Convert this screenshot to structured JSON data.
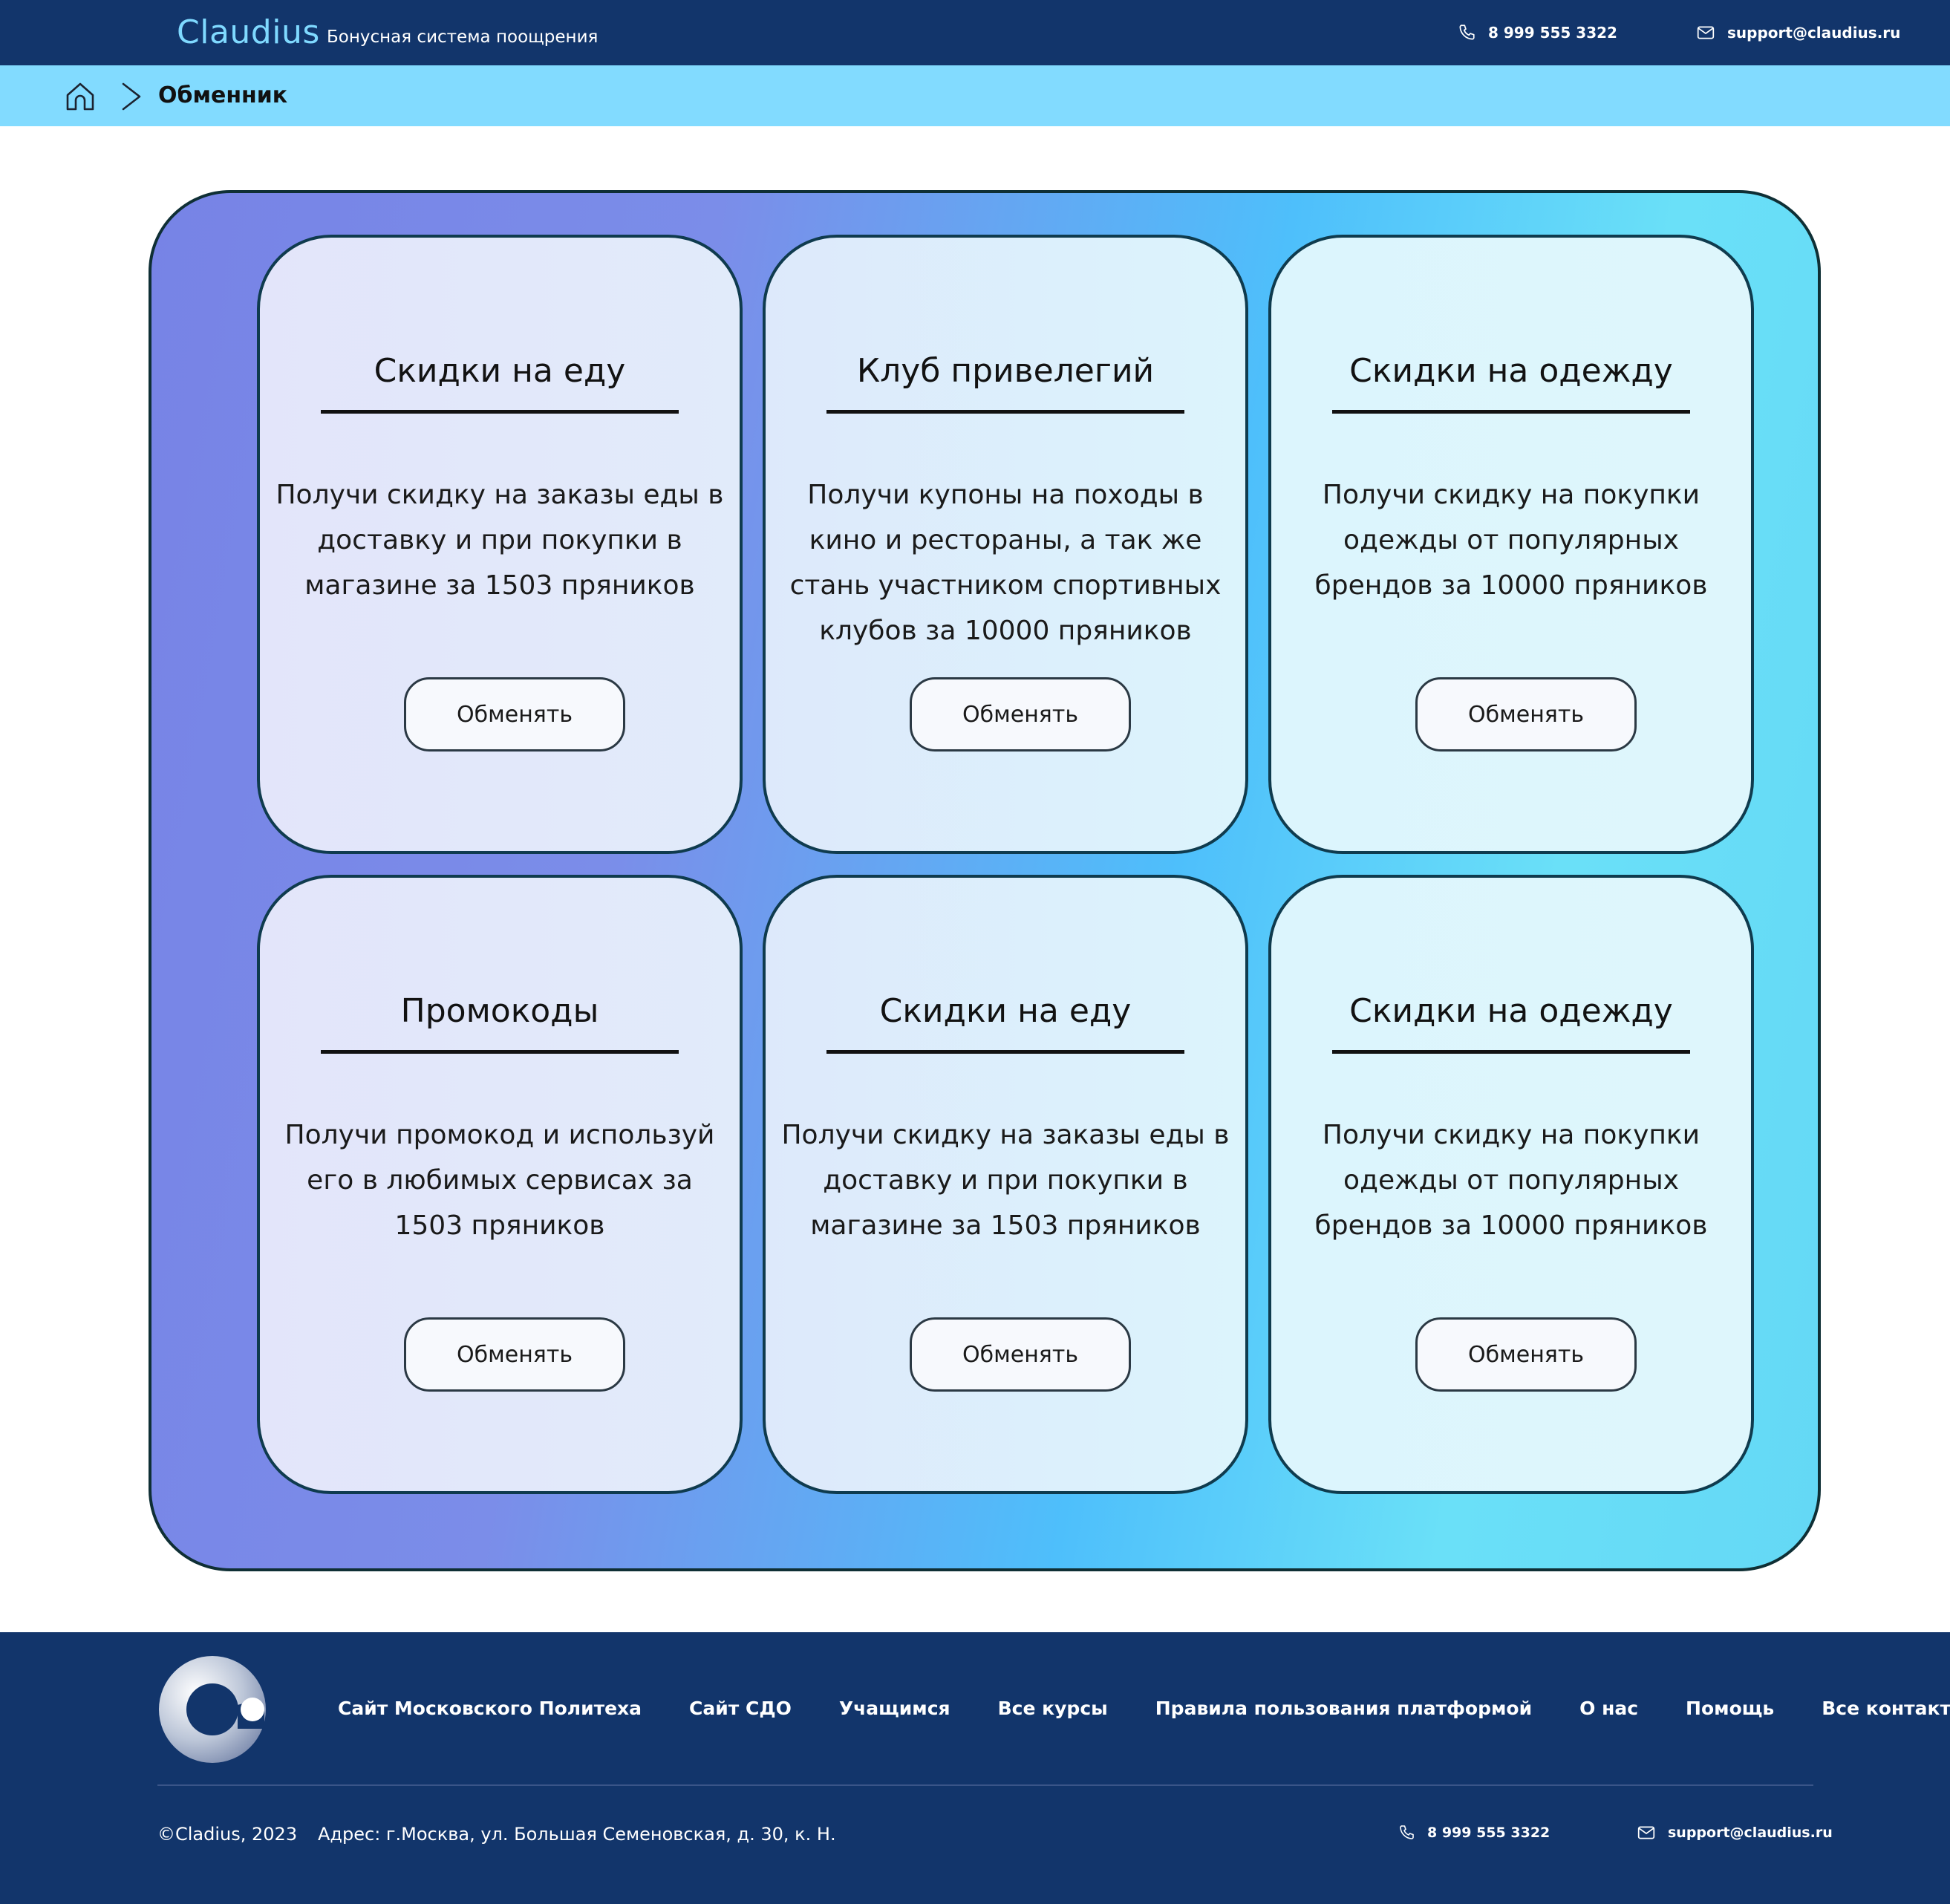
{
  "header": {
    "brand": "Claudius",
    "tagline": "Бонусная система поощрения",
    "phone": "8 999 555 3322",
    "email": "support@claudius.ru",
    "phone_icon": "phone-icon",
    "email_icon": "envelope-icon"
  },
  "breadcrumb": {
    "home_icon": "home-icon",
    "separator_icon": "chevron-right-icon",
    "current": "Обменник"
  },
  "cards": [
    {
      "title": "Скидки на еду",
      "description": "Получи скидку на заказы еды в доставку и при покупки в магазине за 1503 пряников",
      "button": "Обменять"
    },
    {
      "title": "Клуб привелегий",
      "description": "Получи купоны на походы в кино и рестораны, а так же стань участником спортивных клубов за 10000 пряников",
      "button": "Обменять"
    },
    {
      "title": "Скидки на одежду",
      "description": "Получи скидку на покупки одежды от популярных брендов за 10000 пряников",
      "button": "Обменять"
    },
    {
      "title": "Промокоды",
      "description": "Получи промокод и используй его в любимых сервисах за 1503 пряников",
      "button": "Обменять"
    },
    {
      "title": "Скидки на еду",
      "description": "Получи скидку на заказы еды в доставку и при покупки в магазине за 1503 пряников",
      "button": "Обменять"
    },
    {
      "title": "Скидки на одежду",
      "description": "Получи скидку на покупки одежды от популярных брендов за 10000 пряников",
      "button": "Обменять"
    }
  ],
  "footer": {
    "nav": [
      "Сайт Московского Политеха",
      "Сайт СДО",
      "Учащимся",
      "Все курсы",
      "Правила пользования платформой",
      "О нас",
      "Помощь",
      "Все контакты"
    ],
    "copyright": "©Cladius, 2023",
    "address": "Адрес: г.Москва, ул. Большая Семеновская, д. 30, к. Н.",
    "phone": "8 999 555 3322",
    "email": "support@claudius.ru"
  },
  "colors": {
    "header_bg": "#12356b",
    "brand": "#7fd9ff",
    "breadcrumb_bg": "#82dbff",
    "card_bg_left": "#e4e7f9",
    "card_bg_right": "#dff6fc"
  }
}
